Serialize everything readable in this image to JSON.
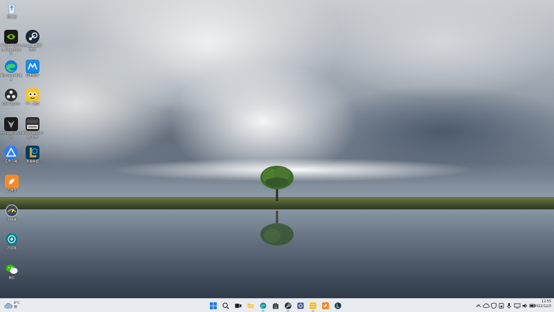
{
  "desktop": {
    "icons": [
      {
        "id": "recycle-bin",
        "label": "回收站",
        "icon": "recycle-bin-icon",
        "color": "#d9e6f2"
      },
      {
        "id": "geforce",
        "label": "NVIDIA GeForce Experience",
        "icon": "geforce-experience-icon",
        "color": "#76b900"
      },
      {
        "id": "steam-web",
        "label": "steam - 桌面 · 网页",
        "icon": "steam-icon",
        "color": "#1b2838"
      },
      {
        "id": "edge",
        "label": "Microsoft Edge",
        "icon": "edge-icon",
        "color": "#0f7bd6"
      },
      {
        "id": "app-blue",
        "label": "应用程序",
        "icon": "app-blue-icon",
        "color": "#1e88e5"
      },
      {
        "id": "obs",
        "label": "OBS Studio",
        "icon": "obs-icon",
        "color": "#302e31"
      },
      {
        "id": "yy",
        "label": "YY - 语音",
        "icon": "yy-icon",
        "color": "#f4c430"
      },
      {
        "id": "predator",
        "label": "PredatorSense",
        "icon": "predator-icon",
        "color": "#1c1c1c"
      },
      {
        "id": "msi-afterburner",
        "label": "MSI Afterburner 超频",
        "icon": "msi-afterburner-icon",
        "color": "#2b2b2b"
      },
      {
        "id": "app-triangle",
        "label": "应用下载",
        "icon": "triangle-app-icon",
        "color": "#2f7df6"
      },
      {
        "id": "lol",
        "label": "英雄联盟",
        "icon": "league-icon",
        "color": "#0a3b5c"
      },
      {
        "id": "app-orange",
        "label": "应用宝",
        "icon": "orange-app-icon",
        "color": "#f28c28"
      },
      {
        "id": "speed",
        "label": "加速器",
        "icon": "speedometer-icon",
        "color": "#3d4957"
      },
      {
        "id": "browser-cyan",
        "label": "浏览器",
        "icon": "globe-app-icon",
        "color": "#0b7a8a"
      },
      {
        "id": "wechat",
        "label": "微信",
        "icon": "wechat-icon",
        "color": "#2dc100"
      }
    ]
  },
  "taskbar": {
    "weather": {
      "temp": "8°C",
      "condition": "阴",
      "icon": "cloud-icon"
    },
    "apps": [
      {
        "id": "start",
        "icon": "windows-start-icon",
        "color": "#1f7ae0"
      },
      {
        "id": "search",
        "icon": "search-icon",
        "color": "#222222"
      },
      {
        "id": "task-view",
        "icon": "task-view-icon",
        "color": "#222222"
      },
      {
        "id": "file-explorer",
        "icon": "folder-icon",
        "color": "#f5c342"
      },
      {
        "id": "edge",
        "icon": "edge-icon",
        "color": "#0f7bd6"
      },
      {
        "id": "store",
        "icon": "store-icon",
        "color": "#2a3b55"
      },
      {
        "id": "steam",
        "icon": "steam-icon",
        "color": "#1b2838"
      },
      {
        "id": "app-gear",
        "icon": "gear-app-icon",
        "color": "#3d5a80"
      },
      {
        "id": "yy",
        "icon": "yy-icon",
        "color": "#f4c430"
      },
      {
        "id": "app-orange",
        "icon": "orange-app-icon",
        "color": "#f28c28"
      },
      {
        "id": "lol",
        "icon": "league-icon",
        "color": "#0a3b5c"
      }
    ],
    "tray": {
      "icons": [
        "chevron-up-icon",
        "cloud-tray-icon",
        "shield-icon",
        "speaker-icon",
        "microphone-icon",
        "network-icon",
        "volume-icon",
        "battery-icon"
      ],
      "time": "12:55",
      "date": "2022/12/3"
    }
  }
}
